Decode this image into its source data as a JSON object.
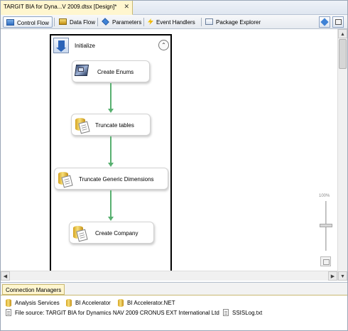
{
  "document_tab": {
    "title": "TARGIT BIA for Dyna...V 2009.dtsx [Design]*",
    "close_glyph": "✕"
  },
  "designer_tabs": [
    {
      "label": "Control Flow",
      "icon": "control-flow-icon",
      "active": true
    },
    {
      "label": "Data Flow",
      "icon": "data-flow-icon",
      "active": false
    },
    {
      "label": "Parameters",
      "icon": "parameters-icon",
      "active": false
    },
    {
      "label": "Event Handlers",
      "icon": "event-handlers-icon",
      "active": false
    },
    {
      "label": "Package Explorer",
      "icon": "package-explorer-icon",
      "active": false
    }
  ],
  "container": {
    "title": "Initialize",
    "collapse_glyph": "⌃",
    "icon": "sequence-container-icon"
  },
  "tasks": [
    {
      "label": "Create Enums",
      "icon": "script-task-icon"
    },
    {
      "label": "Truncate tables",
      "icon": "sql-task-icon"
    },
    {
      "label": "Truncate Generic Dimensions",
      "icon": "sql-task-icon"
    },
    {
      "label": "Create Company",
      "icon": "sql-task-icon"
    }
  ],
  "zoom": {
    "label": "100%",
    "level_percent": 100
  },
  "connection_managers": {
    "tab_label": "Connection Managers",
    "items": [
      {
        "label": "Analysis Services",
        "icon": "database-icon"
      },
      {
        "label": "BI Accelerator",
        "icon": "database-icon"
      },
      {
        "label": "BI Accelerator.NET",
        "icon": "database-icon"
      },
      {
        "label": "File source: TARGIT BIA for Dynamics NAV 2009 CRONUS EXT International Ltd",
        "icon": "file-icon"
      },
      {
        "label": "SSISLog.txt",
        "icon": "file-icon"
      }
    ]
  },
  "colors": {
    "accent_tab": "#fff6cf",
    "precedence_connector": "#58b070",
    "selection_border": "#000000"
  }
}
